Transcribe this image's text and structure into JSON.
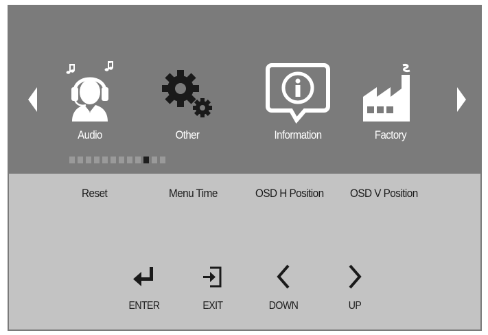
{
  "osd": {
    "menu_items": [
      {
        "label": "Audio",
        "icon": "headphones-person-icon"
      },
      {
        "label": "Other",
        "icon": "gears-icon"
      },
      {
        "label": "Information",
        "icon": "info-bubble-icon"
      },
      {
        "label": "Factory",
        "icon": "factory-icon"
      }
    ],
    "page_indicator": {
      "total": 12,
      "active_index": 9
    },
    "sub_items": [
      "Reset",
      "Menu Time",
      "OSD H Position",
      "OSD V Position"
    ],
    "keys": [
      {
        "label": "ENTER",
        "icon": "enter-return-icon"
      },
      {
        "label": "EXIT",
        "icon": "exit-icon"
      },
      {
        "label": "DOWN",
        "icon": "chevron-left-icon"
      },
      {
        "label": "UP",
        "icon": "chevron-right-icon"
      }
    ],
    "colors": {
      "top_panel": "#7b7b7b",
      "bottom_panel": "#c3c3c3",
      "border": "#7a7a7a",
      "icon": "#ffffff",
      "text_dark": "#1a1a1a"
    }
  }
}
